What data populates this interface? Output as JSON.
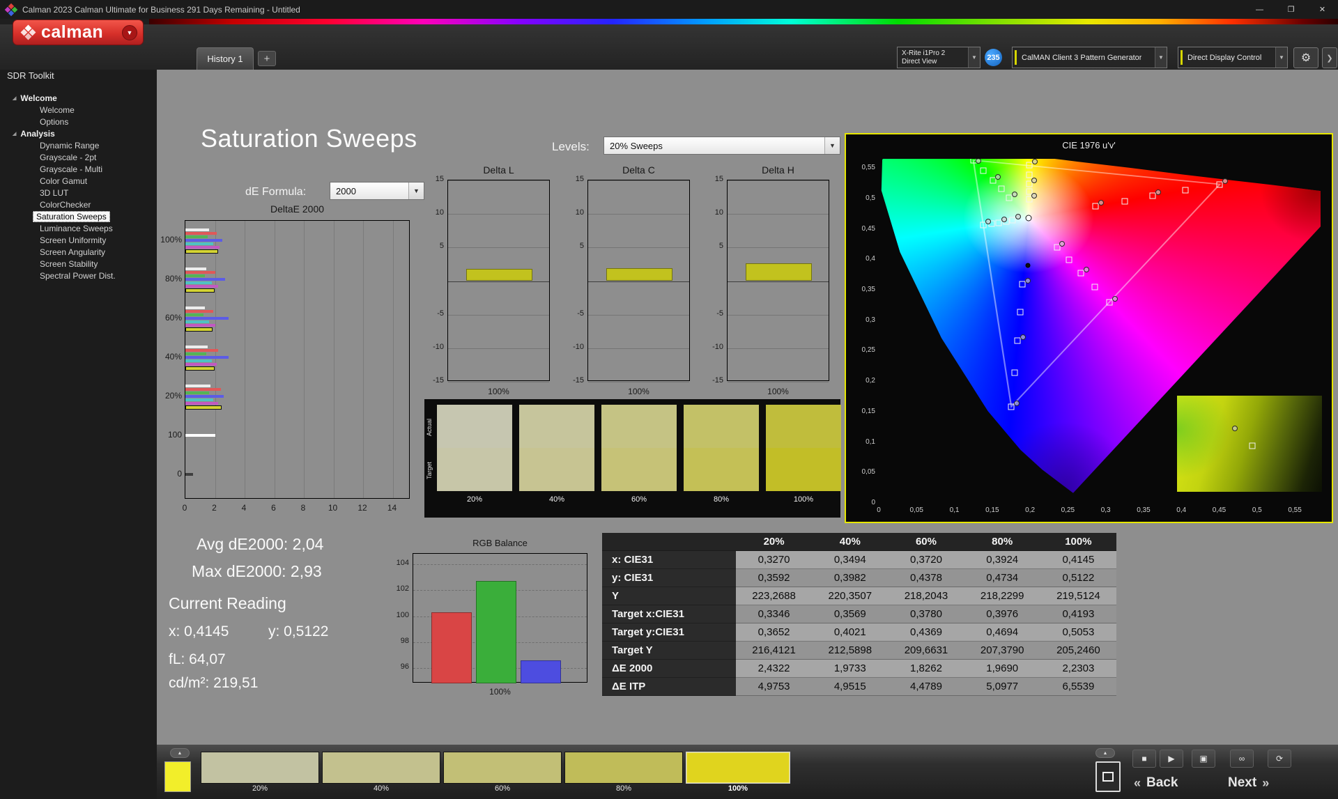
{
  "titlebar": {
    "title": "Calman 2023 Calman Ultimate for Business 291 Days Remaining  - Untitled"
  },
  "ui": {
    "minimize": "—",
    "maximize": "❐",
    "close": "✕",
    "chevron_down": "▼",
    "up_arrow": "▲",
    "plus": "+",
    "collapse_left": "◀",
    "expander": "◢",
    "gear": "⚙",
    "more": "❯",
    "stop": "■",
    "play": "▶",
    "capture": "▣",
    "infinity": "∞",
    "loop": "⟳",
    "back_chev": "«",
    "next_chev": "»"
  },
  "logo": {
    "text": "calman"
  },
  "tabbar": {
    "history_tab": "History 1",
    "meter_line1": "X-Rite i1Pro 2",
    "meter_line2": "Direct View",
    "badge": "235",
    "pattern_generator": "CalMAN Client 3 Pattern Generator",
    "display_control": "Direct Display Control"
  },
  "sidebar": {
    "title": "SDR Toolkit",
    "groups": [
      {
        "label": "Welcome",
        "items": [
          {
            "label": "Welcome"
          },
          {
            "label": "Options"
          }
        ]
      },
      {
        "label": "Analysis",
        "items": [
          {
            "label": "Dynamic Range"
          },
          {
            "label": "Grayscale - 2pt"
          },
          {
            "label": "Grayscale - Multi"
          },
          {
            "label": "Color Gamut"
          },
          {
            "label": "3D LUT"
          },
          {
            "label": "ColorChecker"
          },
          {
            "label": "Saturation Sweeps",
            "selected": true
          },
          {
            "label": "Luminance Sweeps"
          },
          {
            "label": "Screen Uniformity"
          },
          {
            "label": "Screen Angularity"
          },
          {
            "label": "Screen Stability"
          },
          {
            "label": "Spectral Power Dist."
          }
        ]
      }
    ]
  },
  "page": {
    "title": "Saturation Sweeps",
    "de_formula_label": "dE Formula:",
    "de_formula_value": "2000",
    "levels_label": "Levels:",
    "levels_value": "20% Sweeps"
  },
  "readings": {
    "avg": "Avg dE2000: 2,04",
    "max": "Max dE2000: 2,93",
    "current_title": "Current Reading",
    "x": "x: 0,4145",
    "y": "y: 0,5122",
    "fl": "fL: 64,07",
    "cdm2": "cd/m²: 219,51"
  },
  "swatch_panel": {
    "row_labels": [
      "Actual",
      "Target"
    ],
    "columns": [
      {
        "label": "20%",
        "actual": "#c6c6b0",
        "target": "#c7c6a8"
      },
      {
        "label": "40%",
        "actual": "#c6c59c",
        "target": "#c7c492"
      },
      {
        "label": "60%",
        "actual": "#c5c384",
        "target": "#c6c277"
      },
      {
        "label": "80%",
        "actual": "#c3c167",
        "target": "#c4c056"
      },
      {
        "label": "100%",
        "actual": "#c0bd3c",
        "target": "#c2be27"
      }
    ]
  },
  "table": {
    "headers": [
      "20%",
      "40%",
      "60%",
      "80%",
      "100%"
    ],
    "rows": [
      {
        "label": "x: CIE31",
        "values": [
          "0,3270",
          "0,3494",
          "0,3720",
          "0,3924",
          "0,4145"
        ]
      },
      {
        "label": "y: CIE31",
        "values": [
          "0,3592",
          "0,3982",
          "0,4378",
          "0,4734",
          "0,5122"
        ]
      },
      {
        "label": "Y",
        "values": [
          "223,2688",
          "220,3507",
          "218,2043",
          "218,2299",
          "219,5124"
        ]
      },
      {
        "label": "Target x:CIE31",
        "values": [
          "0,3346",
          "0,3569",
          "0,3780",
          "0,3976",
          "0,4193"
        ]
      },
      {
        "label": "Target y:CIE31",
        "values": [
          "0,3652",
          "0,4021",
          "0,4369",
          "0,4694",
          "0,5053"
        ]
      },
      {
        "label": "Target Y",
        "values": [
          "216,4121",
          "212,5898",
          "209,6631",
          "207,3790",
          "205,2460"
        ]
      },
      {
        "label": "ΔE 2000",
        "values": [
          "2,4322",
          "1,9733",
          "1,8262",
          "1,9690",
          "2,2303"
        ]
      },
      {
        "label": "ΔE ITP",
        "values": [
          "4,9753",
          "4,9515",
          "4,4789",
          "5,0977",
          "6,5539"
        ]
      }
    ]
  },
  "bottombar": {
    "pattern_color": "#f2ee2a",
    "swatches": [
      {
        "label": "20%",
        "color": "#c2c2a2"
      },
      {
        "label": "40%",
        "color": "#c3c18e"
      },
      {
        "label": "60%",
        "color": "#c2bf76"
      },
      {
        "label": "80%",
        "color": "#c0bc59"
      },
      {
        "label": "100%",
        "color": "#e0d41e",
        "selected": true
      }
    ],
    "back": "Back",
    "next": "Next"
  },
  "chart_data": {
    "deltae2000": {
      "type": "bar",
      "orientation": "horizontal",
      "title": "DeltaE 2000",
      "xticks": [
        0,
        2,
        4,
        6,
        8,
        10,
        12,
        14
      ],
      "xmax": 15.2,
      "colors": [
        "#ededed",
        "#e05858",
        "#55b455",
        "#5c5ce6",
        "#4ec2c2",
        "#c258c2",
        "#d4d434"
      ],
      "groups": [
        {
          "label": "100%",
          "values": [
            1.6,
            2.1,
            1.5,
            2.5,
            1.9,
            2.3,
            2.23
          ],
          "outline": 6
        },
        {
          "label": "80%",
          "values": [
            1.4,
            2.0,
            1.3,
            2.7,
            1.8,
            2.2,
            1.97
          ],
          "outline": 6
        },
        {
          "label": "60%",
          "values": [
            1.3,
            1.9,
            1.2,
            2.9,
            1.6,
            2.0,
            1.83
          ],
          "outline": 6
        },
        {
          "label": "40%",
          "values": [
            1.5,
            2.2,
            1.4,
            2.93,
            1.8,
            2.1,
            1.97
          ],
          "outline": 6
        },
        {
          "label": "20%",
          "values": [
            1.7,
            2.4,
            1.6,
            2.6,
            1.9,
            2.2,
            2.43
          ],
          "outline": 6
        },
        {
          "label": "100",
          "values": [
            2.0
          ],
          "outline": -1,
          "colors": [
            "#ffffff"
          ]
        },
        {
          "label": "0",
          "values": [
            0.5
          ],
          "outline": -1,
          "colors": [
            "#3f3f3f"
          ]
        }
      ]
    },
    "delta_l": {
      "type": "bar",
      "title": "Delta L",
      "ylim": [
        -15,
        15
      ],
      "yticks": [
        15,
        10,
        5,
        -5,
        -10,
        -15
      ],
      "category": "100%",
      "value": 1.8,
      "color": "#c2c21e"
    },
    "delta_c": {
      "type": "bar",
      "title": "Delta C",
      "ylim": [
        -15,
        15
      ],
      "yticks": [
        15,
        10,
        5,
        -5,
        -10,
        -15
      ],
      "category": "100%",
      "value": 1.9,
      "color": "#c2c21e"
    },
    "delta_h": {
      "type": "bar",
      "title": "Delta H",
      "ylim": [
        -15,
        15
      ],
      "yticks": [
        15,
        10,
        5,
        -5,
        -10,
        -15
      ],
      "category": "100%",
      "value": 2.6,
      "color": "#c2c21e"
    },
    "rgb_balance": {
      "type": "bar",
      "title": "RGB Balance",
      "categories": [
        "Red",
        "Green",
        "Blue"
      ],
      "values": [
        100.3,
        102.7,
        96.6
      ],
      "colors": [
        "#d94545",
        "#3aae3a",
        "#4d4de0"
      ],
      "yticks": [
        104,
        102,
        100,
        98,
        96
      ],
      "ylim": [
        94.8,
        104.8
      ],
      "xtick": "100%"
    },
    "cie": {
      "type": "scatter",
      "title": "CIE 1976 u'v'",
      "xticks": [
        "0",
        "0,05",
        "0,1",
        "0,15",
        "0,2",
        "0,25",
        "0,3",
        "0,35",
        "0,4",
        "0,45",
        "0,5",
        "0,55"
      ],
      "yticks": [
        "0",
        "0,05",
        "0,1",
        "0,15",
        "0,2",
        "0,25",
        "0,3",
        "0,35",
        "0,4",
        "0,45",
        "0,5",
        "0,55"
      ],
      "xlim": [
        0,
        0.584
      ],
      "ylim": [
        0,
        0.565
      ],
      "markers": {
        "squares": [
          [
            34.0,
            11.8
          ],
          [
            34.0,
            9.6
          ],
          [
            34.0,
            7.3
          ],
          [
            34.1,
            4.7
          ],
          [
            34.1,
            1.9
          ],
          [
            29.5,
            11.3
          ],
          [
            27.7,
            8.8
          ],
          [
            25.8,
            6.3
          ],
          [
            23.7,
            3.4
          ],
          [
            21.4,
            0.4
          ],
          [
            49.1,
            13.8
          ],
          [
            55.6,
            12.3
          ],
          [
            62.0,
            10.8
          ],
          [
            69.4,
            9.2
          ],
          [
            77.2,
            7.4
          ],
          [
            32.5,
            36.4
          ],
          [
            32.0,
            44.6
          ],
          [
            31.4,
            52.8
          ],
          [
            30.7,
            62.1
          ],
          [
            30.0,
            72.0
          ],
          [
            30.3,
            17.9
          ],
          [
            28.8,
            18.3
          ],
          [
            27.2,
            18.6
          ],
          [
            25.5,
            18.9
          ],
          [
            23.6,
            19.3
          ],
          [
            40.3,
            25.7
          ],
          [
            43.1,
            29.4
          ],
          [
            45.8,
            33.1
          ],
          [
            48.9,
            37.2
          ],
          [
            52.2,
            41.6
          ]
        ],
        "circles": [
          [
            35.2,
            10.8
          ],
          [
            35.2,
            6.3
          ],
          [
            35.3,
            0.9
          ],
          [
            30.7,
            10.3
          ],
          [
            27.0,
            5.3
          ],
          [
            22.6,
            0.6
          ],
          [
            50.3,
            12.8
          ],
          [
            63.2,
            9.8
          ],
          [
            78.4,
            6.4
          ],
          [
            33.7,
            35.4
          ],
          [
            32.6,
            51.8
          ],
          [
            31.2,
            71.0
          ],
          [
            31.5,
            16.9
          ],
          [
            28.4,
            17.6
          ],
          [
            24.8,
            18.3
          ],
          [
            41.5,
            24.7
          ],
          [
            47.0,
            32.1
          ],
          [
            53.4,
            40.6
          ]
        ],
        "dot": [
          33.7,
          31.0
        ],
        "white": [
          33.9,
          17.2
        ]
      },
      "inset_markers": {
        "circle": [
          40,
          34
        ],
        "square": [
          52,
          52
        ]
      }
    }
  }
}
